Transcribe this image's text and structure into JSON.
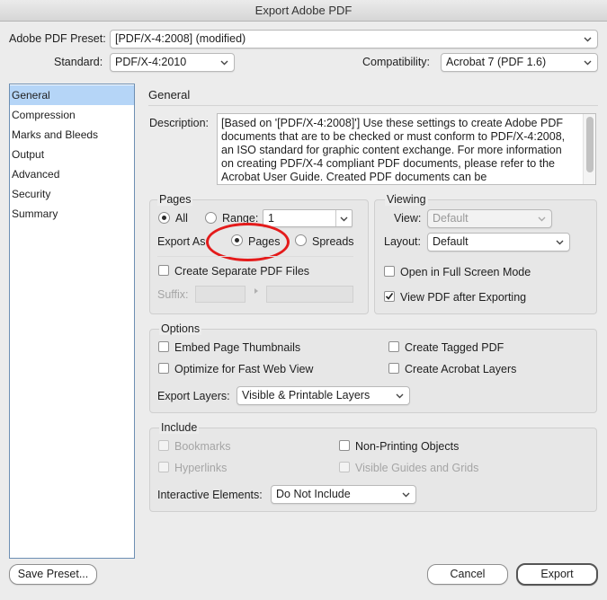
{
  "window": {
    "title": "Export Adobe PDF"
  },
  "header": {
    "preset_label": "Adobe PDF Preset:",
    "preset_value": "[PDF/X-4:2008] (modified)",
    "standard_label": "Standard:",
    "standard_value": "PDF/X-4:2010",
    "compat_label": "Compatibility:",
    "compat_value": "Acrobat 7 (PDF 1.6)"
  },
  "sidebar": {
    "items": [
      {
        "label": "General",
        "selected": true
      },
      {
        "label": "Compression"
      },
      {
        "label": "Marks and Bleeds"
      },
      {
        "label": "Output"
      },
      {
        "label": "Advanced"
      },
      {
        "label": "Security"
      },
      {
        "label": "Summary"
      }
    ]
  },
  "general": {
    "title": "General",
    "desc_label": "Description:",
    "description": "[Based on '[PDF/X-4:2008]'] Use these settings to create Adobe PDF documents that are to be checked or must conform to PDF/X-4:2008, an ISO standard for graphic content exchange.  For more information on creating PDF/X-4 compliant PDF documents, please refer to the Acrobat User Guide.  Created PDF documents can be"
  },
  "pages": {
    "title": "Pages",
    "all_label": "All",
    "range_label": "Range:",
    "range_value": "1",
    "export_as_label": "Export As",
    "pages_label": "Pages",
    "spreads_label": "Spreads",
    "separate_files_label": "Create Separate PDF Files",
    "suffix_label": "Suffix:"
  },
  "viewing": {
    "title": "Viewing",
    "view_label": "View:",
    "view_value": "Default",
    "layout_label": "Layout:",
    "layout_value": "Default",
    "fullscreen_label": "Open in Full Screen Mode",
    "view_after_label": "View PDF after Exporting"
  },
  "options": {
    "title": "Options",
    "thumbnails_label": "Embed Page Thumbnails",
    "fast_web_label": "Optimize for Fast Web View",
    "tagged_label": "Create Tagged PDF",
    "acrobat_layers_label": "Create Acrobat Layers",
    "export_layers_label": "Export Layers:",
    "export_layers_value": "Visible & Printable Layers"
  },
  "include": {
    "title": "Include",
    "bookmarks_label": "Bookmarks",
    "hyperlinks_label": "Hyperlinks",
    "nonprinting_label": "Non-Printing Objects",
    "guides_label": "Visible Guides and Grids",
    "interactive_label": "Interactive Elements:",
    "interactive_value": "Do Not Include"
  },
  "footer": {
    "save_preset_label": "Save Preset...",
    "cancel_label": "Cancel",
    "export_label": "Export"
  },
  "colors": {
    "selection": "#b5d5f7",
    "annotation_ring": "#e41b1b"
  }
}
